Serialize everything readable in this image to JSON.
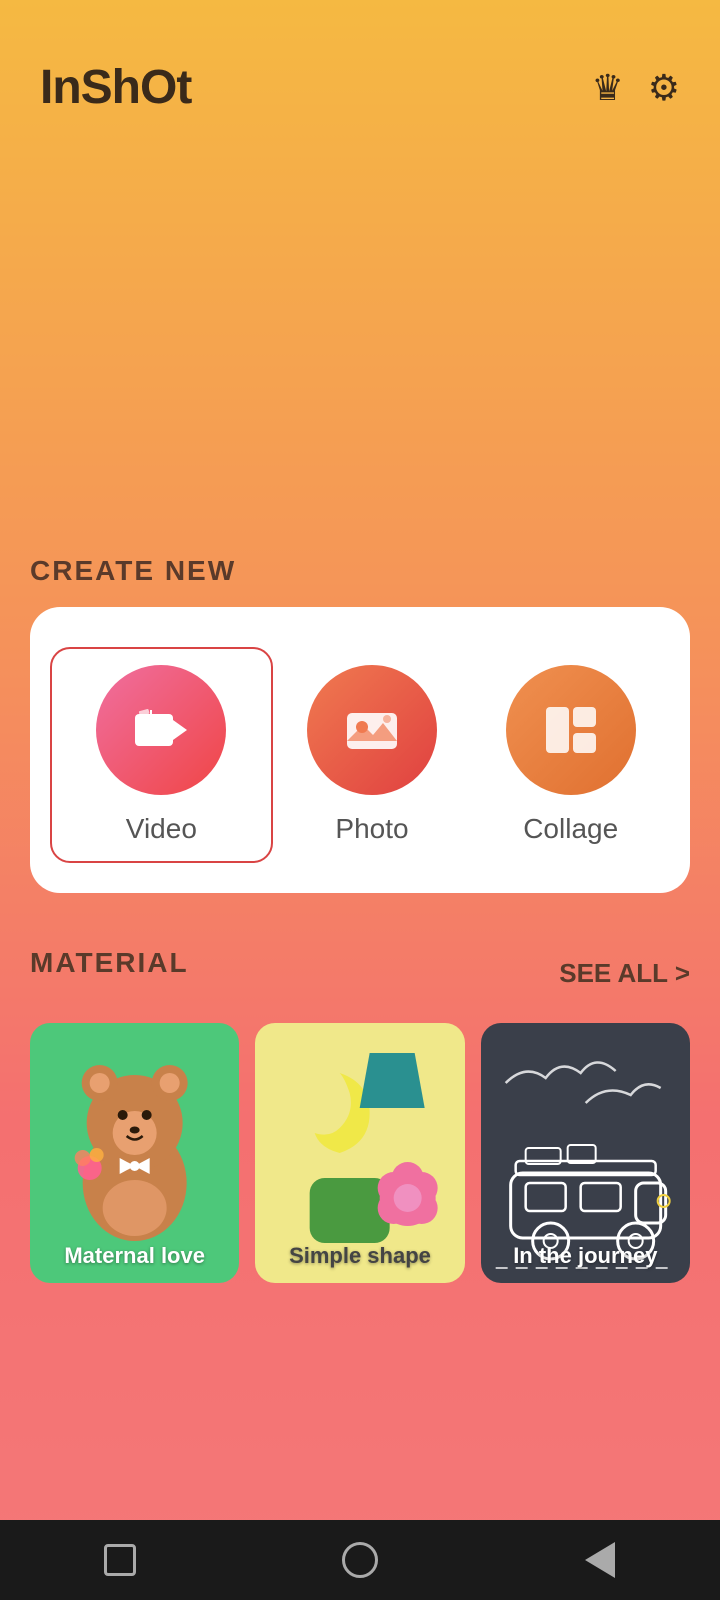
{
  "header": {
    "logo": "InShOt",
    "crown_icon": "♛",
    "gear_icon": "⚙"
  },
  "create_new": {
    "section_label": "CREATE NEW",
    "items": [
      {
        "id": "video",
        "label": "Video",
        "circle_class": "circle-video",
        "icon": "🎬",
        "selected": true
      },
      {
        "id": "photo",
        "label": "Photo",
        "circle_class": "circle-photo",
        "icon": "🖼",
        "selected": false
      },
      {
        "id": "collage",
        "label": "Collage",
        "circle_class": "circle-collage",
        "icon": "⊞",
        "selected": false
      }
    ]
  },
  "material": {
    "section_label": "MATERIAL",
    "see_all_label": "SEE ALL",
    "cards": [
      {
        "id": "maternal-love",
        "label": "Maternal love",
        "bg": "#4dc87a"
      },
      {
        "id": "simple-shape",
        "label": "Simple shape",
        "bg": "#f0e88a"
      },
      {
        "id": "in-the-journey",
        "label": "In the journey",
        "bg": "#3a3f4a"
      }
    ]
  },
  "nav": {
    "square_label": "square",
    "circle_label": "circle",
    "triangle_label": "back"
  }
}
